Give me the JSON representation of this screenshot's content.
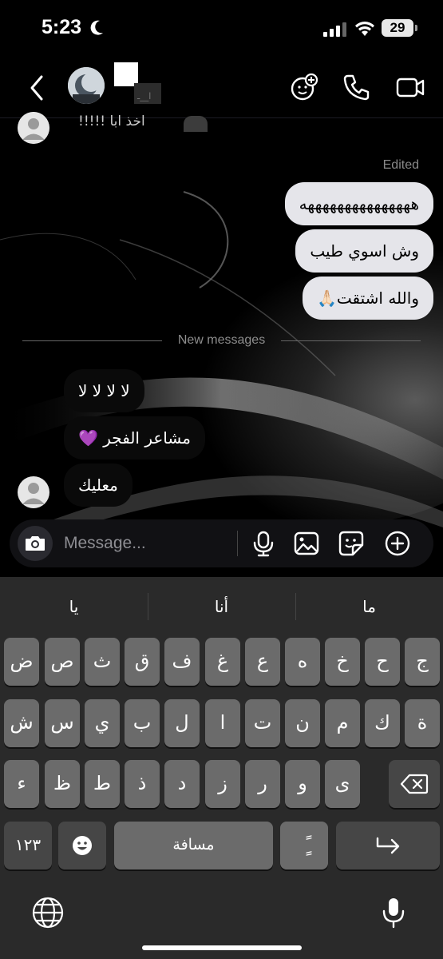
{
  "status_bar": {
    "time": "5:23",
    "battery": "29"
  },
  "header": {
    "subtitle": "ا__ـ"
  },
  "messages": {
    "top_incoming_text": "!!!!!     اخذ ابا",
    "edited_label": "Edited",
    "outgoing": [
      "هههههههههههههههه",
      "وش اسوي طيب",
      "والله اشتقت🙏🏻"
    ],
    "new_messages_label": "New messages",
    "incoming": [
      "لا لا لا لا",
      "مشاعر الفجر 💜",
      "معليك"
    ]
  },
  "composer": {
    "placeholder": "Message..."
  },
  "keyboard": {
    "suggestions": [
      "ما",
      "أنا",
      "يا"
    ],
    "row1": [
      "ج",
      "ح",
      "خ",
      "ه",
      "ع",
      "غ",
      "ف",
      "ق",
      "ث",
      "ص",
      "ض"
    ],
    "row2": [
      "ة",
      "ك",
      "م",
      "ن",
      "ت",
      "ا",
      "ل",
      "ب",
      "ي",
      "س",
      "ش"
    ],
    "row3": [
      "ى",
      "و",
      "ر",
      "ز",
      "د",
      "ذ",
      "ط",
      "ظ",
      "ء"
    ],
    "numbers_label": "١٢٣",
    "space_label": "مسافة",
    "diacritic_label": "ًٍ"
  }
}
